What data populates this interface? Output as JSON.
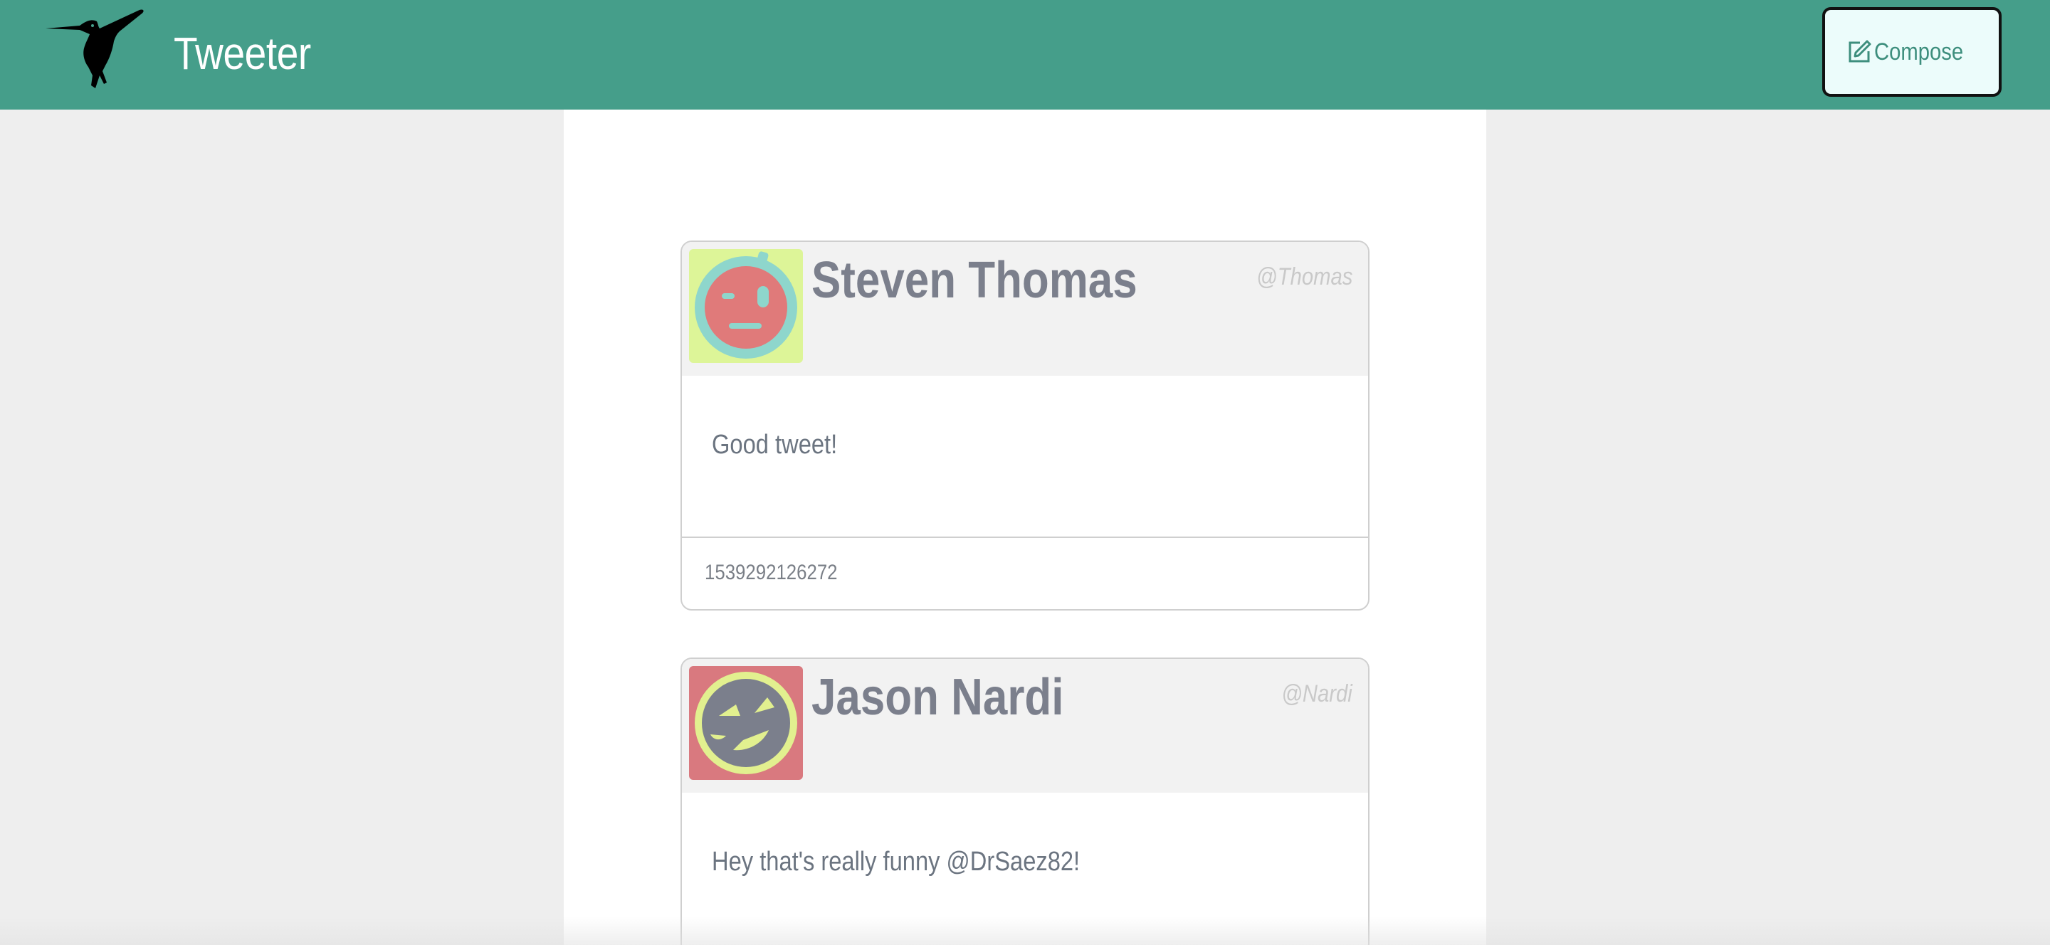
{
  "navbar": {
    "brand_title": "Tweeter",
    "brand_icon": "hummingbird-icon",
    "background_color": "#459e8a",
    "compose": {
      "label": "Compose",
      "icon": "edit-icon"
    }
  },
  "tweets": [
    {
      "name": "Steven Thomas",
      "handle": "@Thomas",
      "text": "Good tweet!",
      "timestamp": "1539292126272",
      "avatar": {
        "icon": "robot-face-avatar-icon",
        "background_color": "#ddf598",
        "ring_color": "#8ed6cc",
        "face_color": "#e07a7a"
      }
    },
    {
      "name": "Jason Nardi",
      "handle": "@Nardi",
      "text": "Hey that's really funny @DrSaez82!",
      "avatar": {
        "icon": "sly-face-avatar-icon",
        "background_color": "#d9797f",
        "ring_color": "#e2f08f",
        "face_color": "#7b7f8c"
      }
    }
  ]
}
